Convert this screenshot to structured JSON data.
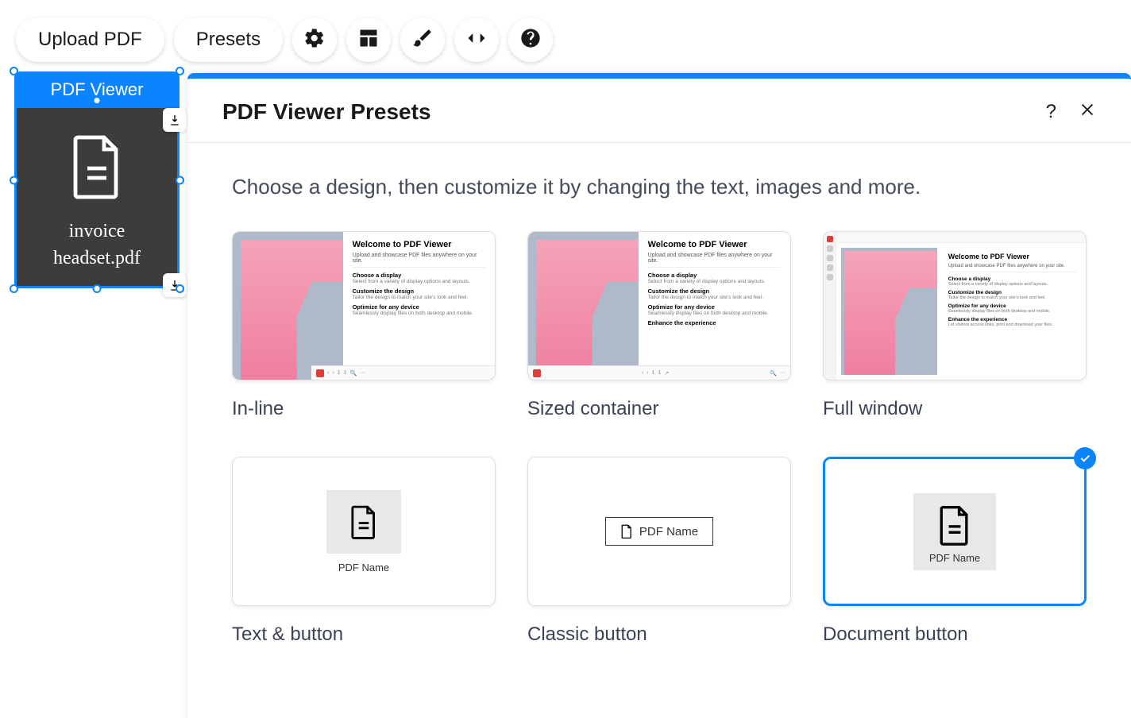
{
  "toolbar": {
    "upload_label": "Upload PDF",
    "presets_label": "Presets"
  },
  "widget": {
    "title": "PDF Viewer",
    "filename_line1": "invoice",
    "filename_line2": "headset.pdf"
  },
  "panel": {
    "title": "PDF Viewer Presets",
    "description": "Choose a design, then customize it by changing the text, images and more."
  },
  "presets": {
    "inline_label": "In-line",
    "sized_label": "Sized container",
    "full_label": "Full window",
    "text_btn_label": "Text & button",
    "classic_btn_label": "Classic button",
    "doc_btn_label": "Document button"
  },
  "thumb": {
    "welcome": "Welcome to PDF Viewer",
    "welcome_sub": "Upload and showcase PDF files anywhere on your site.",
    "choose_display": "Choose a display",
    "choose_display_sub": "Select from a variety of display options and layouts.",
    "customize": "Customize the design",
    "customize_sub": "Tailor the design to match your site's look and feel.",
    "optimize": "Optimize for any device",
    "optimize_sub": "Seamlessly display files on both desktop and mobile.",
    "enhance": "Enhance the experience",
    "enhance_sub": "Let visitors access links, print and download your files.",
    "pdf_name": "PDF Name"
  }
}
